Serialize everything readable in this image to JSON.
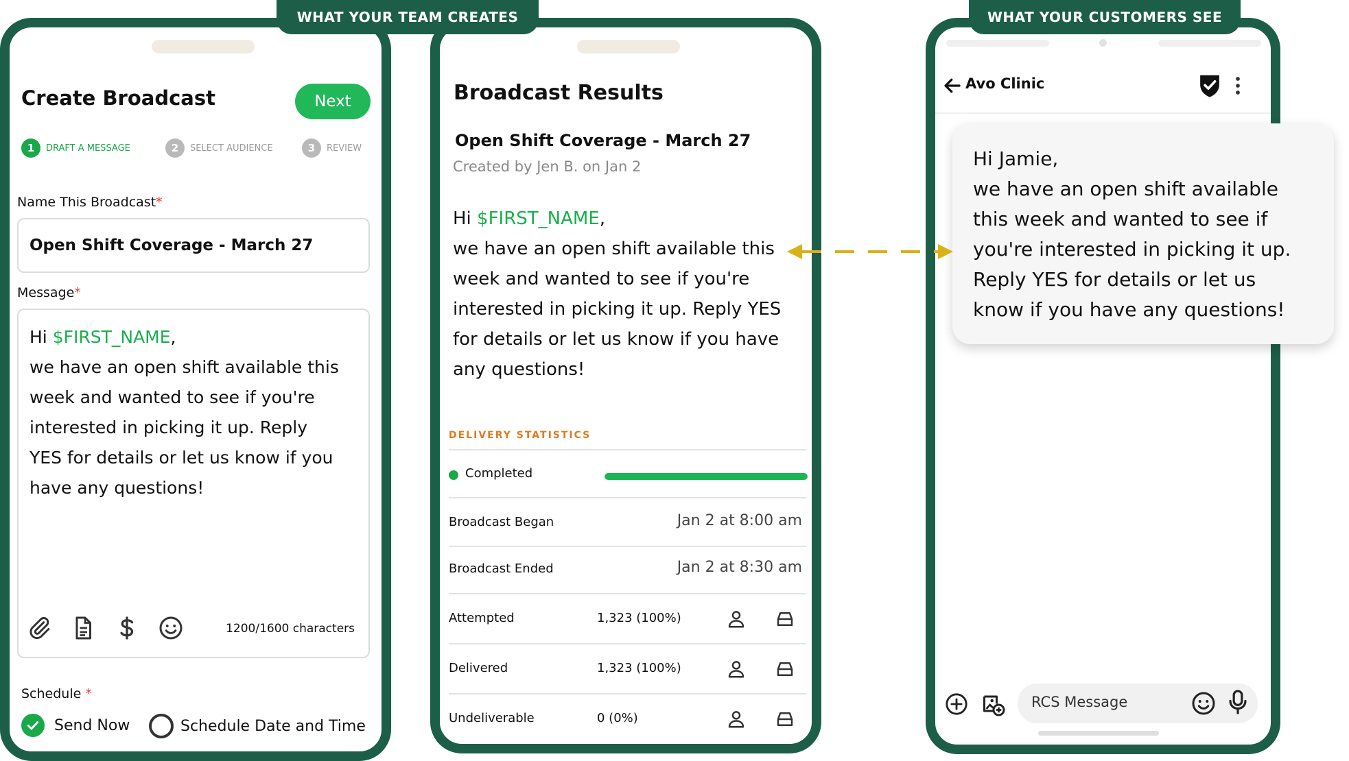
{
  "banners": {
    "left": "WHAT YOUR TEAM CREATES",
    "right": "WHAT YOUR CUSTOMERS SEE"
  },
  "create": {
    "title": "Create Broadcast",
    "next_label": "Next",
    "steps": [
      {
        "num": "1",
        "label": "DRAFT A MESSAGE"
      },
      {
        "num": "2",
        "label": "SELECT AUDIENCE"
      },
      {
        "num": "3",
        "label": "REVIEW"
      }
    ],
    "name_label": "Name This Broadcast",
    "required_mark": "*",
    "name_value": "Open Shift Coverage - March 27",
    "message_label": "Message",
    "message_greeting": "Hi ",
    "message_variable": "$FIRST_NAME",
    "message_comma": ",",
    "message_lines": [
      "we have an open shift available this",
      "week and wanted to see if you're",
      "interested in picking it up. Reply",
      "YES for details or let us know if you",
      "have any questions!"
    ],
    "char_count": "1200/1600 characters",
    "toolbar_icons": [
      "paperclip-icon",
      "document-icon",
      "dollar-icon",
      "emoji-icon"
    ],
    "schedule_label": "Schedule",
    "send_now_label": "Send Now",
    "schedule_option_label": "Schedule Date and Time"
  },
  "results": {
    "title": "Broadcast Results",
    "broadcast_name": "Open Shift Coverage - March 27",
    "created_by": "Created by Jen B. on Jan 2",
    "message_greeting": "Hi ",
    "message_variable": "$FIRST_NAME",
    "message_comma": ",",
    "message_lines": [
      "we have an open shift available this",
      "week and wanted to see if you're",
      "interested in picking it up. Reply YES",
      "for details or let us know if you have",
      "any questions!"
    ],
    "stats_title": "DELIVERY STATISTICS",
    "completed_label": "Completed",
    "completed_progress": 1.0,
    "began_label": "Broadcast Began",
    "began_value": "Jan 2 at 8:00 am",
    "ended_label": "Broadcast Ended",
    "ended_value": "Jan 2 at 8:30 am",
    "rows": [
      {
        "label": "Attempted",
        "value": "1,323 (100%)"
      },
      {
        "label": "Delivered",
        "value": "1,323 (100%)"
      },
      {
        "label": "Undeliverable",
        "value": "0 (0%)"
      }
    ]
  },
  "customer": {
    "contact_name": "Avo Clinic",
    "message_lines": [
      "Hi Jamie,",
      "we have an open shift available",
      "this week and wanted to see if",
      "you're interested in picking it up.",
      "Reply YES for details or let us",
      "know if you have any questions!"
    ],
    "input_placeholder": "RCS Message"
  },
  "colors": {
    "frame": "#1d5e48",
    "accent_green": "#17b04b",
    "stats_orange": "#e07a20",
    "arrow_yellow": "#d9b21b"
  }
}
